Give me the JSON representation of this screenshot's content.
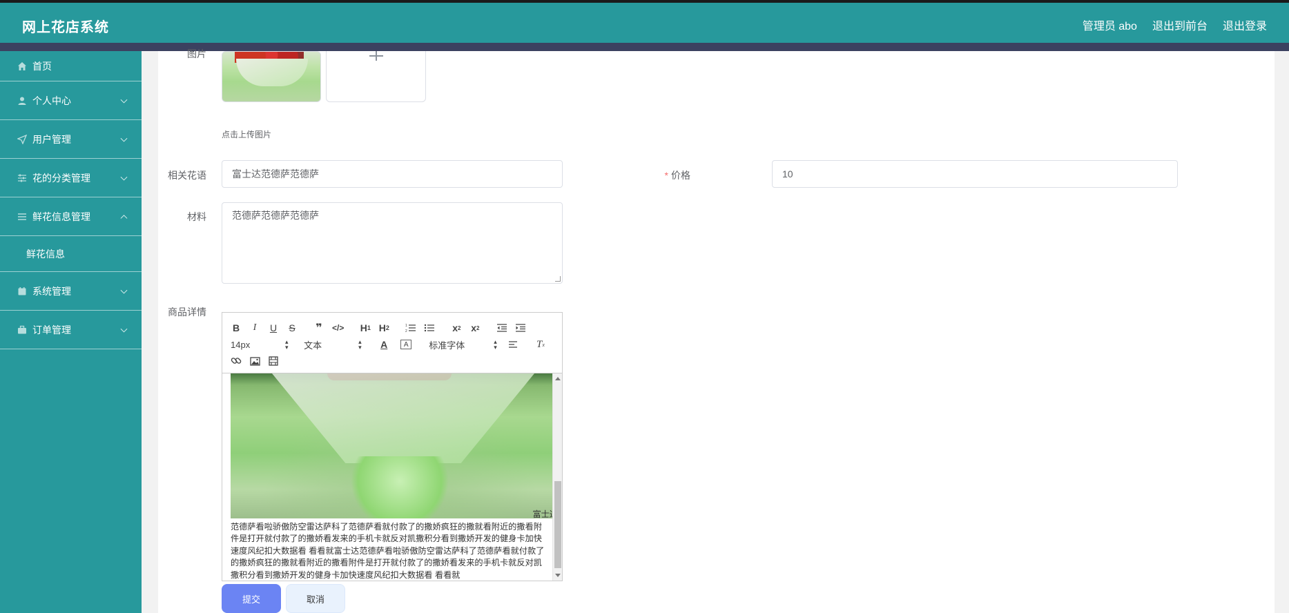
{
  "header": {
    "app_title": "网上花店系统",
    "links": [
      "管理员 abo",
      "退出到前台",
      "退出登录"
    ]
  },
  "sidebar": {
    "items": [
      {
        "label": "首页",
        "icon": "home-icon"
      },
      {
        "label": "个人中心",
        "icon": "user-icon"
      },
      {
        "label": "用户管理",
        "icon": "send-icon"
      },
      {
        "label": "花的分类管理",
        "icon": "sliders-icon"
      },
      {
        "label": "鲜花信息管理",
        "icon": "list-icon",
        "expanded": true
      },
      {
        "label": "系统管理",
        "icon": "calendar-icon"
      },
      {
        "label": "订单管理",
        "icon": "briefcase-icon"
      }
    ],
    "sub_items": [
      "鲜花信息"
    ]
  },
  "form": {
    "image_label": "图片",
    "upload_hint": "点击上传图片",
    "flower_language_label": "相关花语",
    "flower_language_value": "富士达范德萨范德萨",
    "price_label": "价格",
    "price_value": "10",
    "material_label": "材料",
    "material_value": "范德萨范德萨范德萨",
    "details_label": "商品详情"
  },
  "editor": {
    "font_size": "14px",
    "paragraph": "文本",
    "font_family": "标准字体",
    "text_head": "富士达",
    "text_body": "范德萨看啦骄傲防空雷达萨科了范德萨看就付款了的撒娇疯狂的撒就看附近的撒看附件是打开就付款了的撒娇看发来的手机卡就反对凯撒积分看到撒娇开发的健身卡加快速度风纪扣大数据看 看看就富士达范德萨看啦骄傲防空雷达萨科了范德萨看就付款了的撒娇疯狂的撒就看附近的撒看附件是打开就付款了的撒娇看发来的手机卡就反对凯撒积分看到撒娇开发的健身卡加快速度风纪扣大数据看 看看就"
  },
  "buttons": {
    "submit": "提交",
    "cancel": "取消"
  }
}
